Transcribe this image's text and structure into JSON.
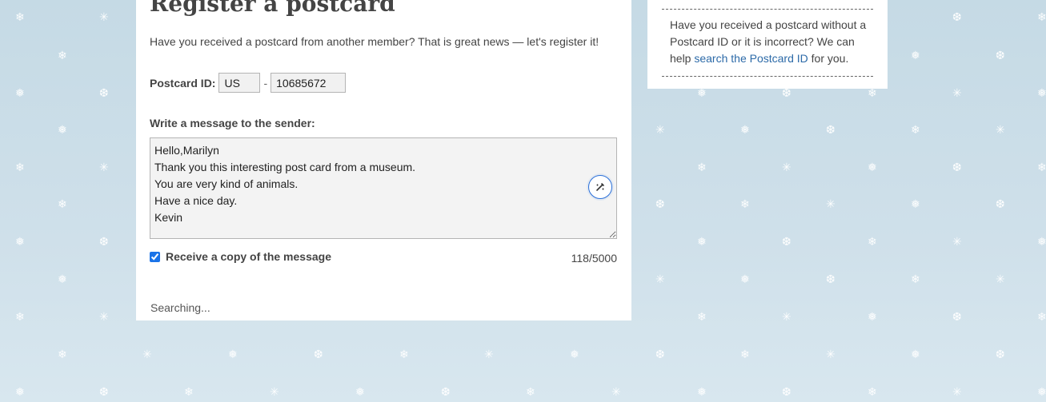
{
  "page": {
    "title": "Register a postcard",
    "intro": "Have you received a postcard from another member? That is great news — let's register it!"
  },
  "postcard_id": {
    "label": "Postcard ID:",
    "country_value": "US",
    "separator": "-",
    "number_value": "10685672"
  },
  "message": {
    "label": "Write a message to the sender:",
    "value": "Hello,Marilyn\nThank you this interesting post card from a museum.\nYou are very kind of animals.\nHave a nice day.\nKevin",
    "char_count": "118/5000"
  },
  "copy_option": {
    "label": "Receive a copy of the message",
    "checked": true
  },
  "status": {
    "text": "Searching..."
  },
  "sidebar": {
    "help_text_before": "Have you received a postcard without a Postcard ID or it is incorrect? We can help ",
    "help_link": "search the Postcard ID",
    "help_text_after": " for you."
  },
  "icons": {
    "grammar_button": "pen-sparkle-icon",
    "snowflake": "snowflake-icon"
  },
  "colors": {
    "background": "#c9dde8",
    "link": "#2c6aa8",
    "accent": "#2a6fd8"
  }
}
